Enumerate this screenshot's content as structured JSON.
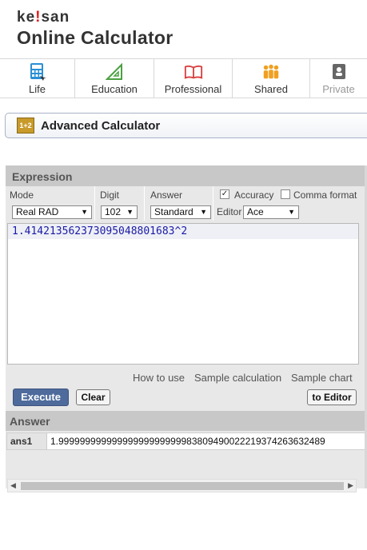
{
  "logo": {
    "small": "ke!san",
    "big": "Online Calculator"
  },
  "nav": [
    {
      "label": "Life",
      "icon": "calculator-icon"
    },
    {
      "label": "Education",
      "icon": "triangle-ruler-icon"
    },
    {
      "label": "Professional",
      "icon": "book-icon"
    },
    {
      "label": "Shared",
      "icon": "people-icon"
    },
    {
      "label": "Private",
      "icon": "address-book-icon"
    }
  ],
  "title": {
    "icon_text": "1+2",
    "text": "Advanced Calculator"
  },
  "expression": {
    "header": "Expression",
    "mode_label": "Mode",
    "mode_value": "Real RAD",
    "digit_label": "Digit",
    "digit_value": "102",
    "answer_label": "Answer",
    "answer_value": "Standard",
    "accuracy_label": "Accuracy",
    "accuracy_checked": true,
    "comma_label": "Comma format",
    "comma_checked": false,
    "editor_label": "Editor",
    "editor_value": "Ace",
    "input": "1.4142135623730950488016 83^2",
    "input_text": "1.41421356237309504880168 3^2"
  },
  "links": {
    "how_to_use": "How to use",
    "sample_calc": "Sample calculation",
    "sample_chart": "Sample chart"
  },
  "buttons": {
    "execute": "Execute",
    "clear": "Clear",
    "to_editor": "to Editor"
  },
  "answer": {
    "header": "Answer",
    "label": "ans1",
    "value": "1.999999999999999999999999838094900222193742636324 89"
  }
}
